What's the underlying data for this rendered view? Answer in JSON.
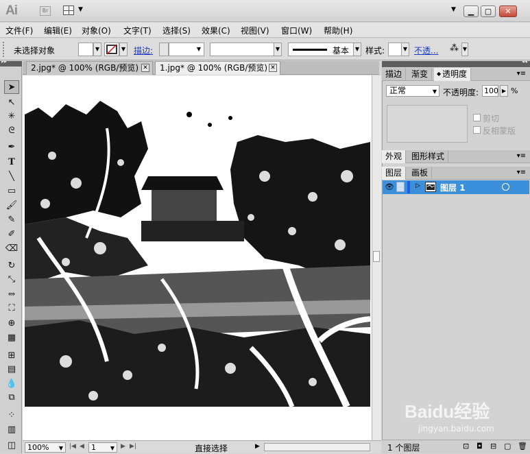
{
  "app": {
    "logo": "Ai",
    "bridge": "Br"
  },
  "menu": [
    "文件(F)",
    "编辑(E)",
    "对象(O)",
    "文字(T)",
    "选择(S)",
    "效果(C)",
    "视图(V)",
    "窗口(W)",
    "帮助(H)"
  ],
  "control_bar": {
    "selection_status": "未选择对象",
    "stroke_label": "描边:",
    "stroke_profile": "基本",
    "style_label": "样式:",
    "opacity_link": "不透..."
  },
  "tabs": [
    {
      "label": "2.jpg* @ 100% (RGB/预览)",
      "close": "✕"
    },
    {
      "label": "1.jpg* @ 100% (RGB/预览)",
      "close": "✕"
    }
  ],
  "status_bar": {
    "zoom": "100%",
    "page": "1",
    "tool": "直接选择"
  },
  "transparency_panel": {
    "tabs": [
      "描边",
      "渐变",
      "透明度"
    ],
    "blend_mode": "正常",
    "opacity_label": "不透明度:",
    "opacity_value": "100",
    "opacity_unit": "%",
    "clip_label": "剪切",
    "invert_mask_label": "反相蒙版"
  },
  "appearance_panel": {
    "tabs": [
      "外观",
      "图形样式"
    ]
  },
  "layers_panel": {
    "tabs": [
      "图层",
      "画板"
    ],
    "layers": [
      {
        "name": "图层 1"
      }
    ],
    "footer_count": "1 个图层"
  },
  "watermark": {
    "text": "Baidu经验",
    "sub": "jingyan.baidu.com"
  },
  "colors": {
    "accent": "#3c8fda",
    "link": "#1a39c4",
    "close_btn": "#c4493a"
  }
}
